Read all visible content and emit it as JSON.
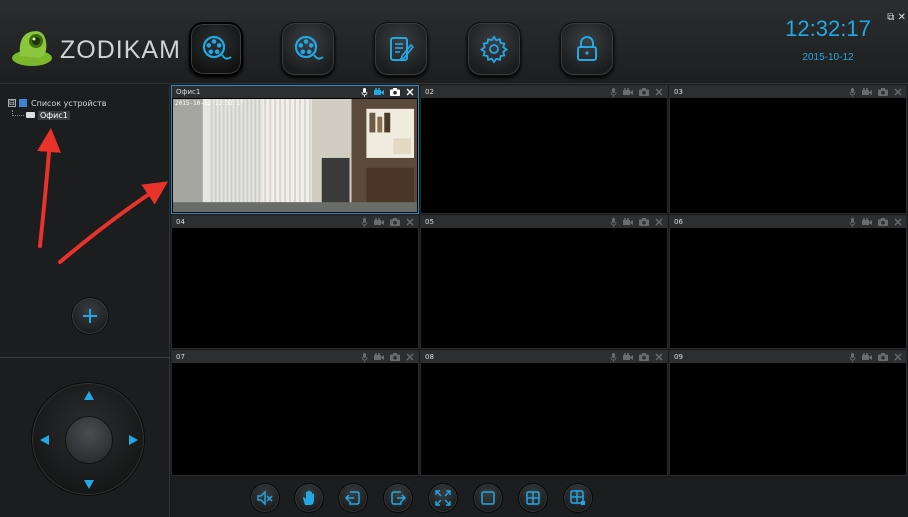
{
  "app": {
    "logo_text": "ZODIKAM",
    "time": "12:32:17",
    "date": "2015-10-12",
    "window_controls": "⧉ ✕"
  },
  "toolbar": {
    "buttons": [
      {
        "id": "live-view",
        "icon": "film-reel-icon",
        "active": true
      },
      {
        "id": "playback",
        "icon": "film-reel-icon",
        "active": false
      },
      {
        "id": "log",
        "icon": "notepad-pen-icon",
        "active": false
      },
      {
        "id": "settings",
        "icon": "gear-icon",
        "active": false
      },
      {
        "id": "lock",
        "icon": "lock-icon",
        "active": false
      }
    ]
  },
  "sidebar": {
    "tree": {
      "root_label": "Список устройств",
      "root_toggle": "⊟",
      "devices": [
        {
          "label": "Офис1",
          "selected": true
        }
      ]
    },
    "add_button": "+"
  },
  "grid": {
    "cells": [
      {
        "title": "Офис1",
        "active": true,
        "has_feed": true,
        "timestamp": "2015-10-12 12:32:17"
      },
      {
        "title": "02",
        "active": false,
        "has_feed": false
      },
      {
        "title": "03",
        "active": false,
        "has_feed": false
      },
      {
        "title": "04",
        "active": false,
        "has_feed": false
      },
      {
        "title": "05",
        "active": false,
        "has_feed": false
      },
      {
        "title": "06",
        "active": false,
        "has_feed": false
      },
      {
        "title": "07",
        "active": false,
        "has_feed": false
      },
      {
        "title": "08",
        "active": false,
        "has_feed": false
      },
      {
        "title": "09",
        "active": false,
        "has_feed": false
      }
    ],
    "cell_icons": [
      "microphone-icon",
      "video-camera-icon",
      "snapshot-camera-icon",
      "close-icon"
    ]
  },
  "bottom_bar": {
    "buttons": [
      {
        "id": "mute",
        "icon": "speaker-mute-icon"
      },
      {
        "id": "stop-all",
        "icon": "hand-icon"
      },
      {
        "id": "previous-page",
        "icon": "page-prev-icon"
      },
      {
        "id": "next-page",
        "icon": "page-next-icon"
      },
      {
        "id": "fullscreen",
        "icon": "fullscreen-icon"
      },
      {
        "id": "layout-1",
        "icon": "layout-single-icon"
      },
      {
        "id": "layout-4",
        "icon": "layout-quad-icon"
      },
      {
        "id": "layout-custom",
        "icon": "layout-custom-icon"
      }
    ]
  },
  "colors": {
    "accent": "#22a8e4",
    "annotation": "#e8322a",
    "background": "#1a1b1c"
  }
}
